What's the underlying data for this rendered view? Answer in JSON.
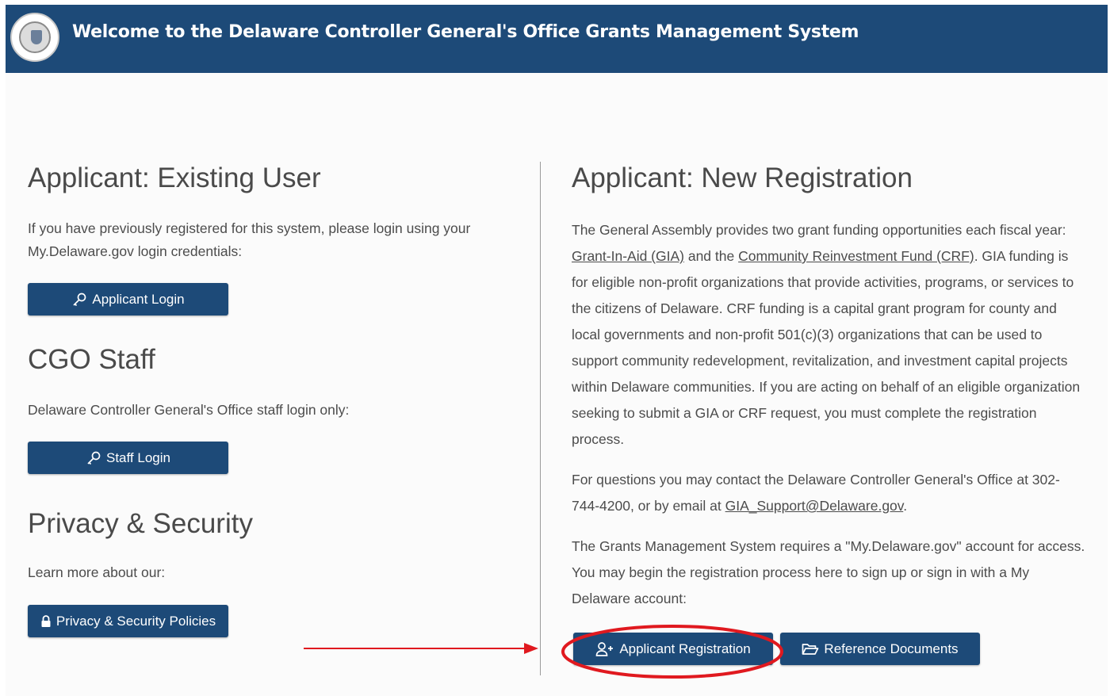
{
  "header": {
    "title": "Welcome to the Delaware Controller General's Office Grants Management System",
    "seal_icon": "delaware-state-seal",
    "background_color": "#1d4a78"
  },
  "existing_user": {
    "heading": "Applicant: Existing User",
    "text": "If you have previously registered for this system, please login using your My.Delaware.gov login credentials:",
    "button_label": "Applicant Login",
    "button_icon": "key-icon"
  },
  "staff": {
    "heading": "CGO Staff",
    "text": "Delaware Controller General's Office staff login only:",
    "button_label": "Staff Login",
    "button_icon": "key-icon"
  },
  "privacy": {
    "heading": "Privacy & Security",
    "text": "Learn more about our:",
    "button_label": "Privacy & Security Policies",
    "button_icon": "lock-icon"
  },
  "registration": {
    "heading": "Applicant: New Registration",
    "p1_a": "The General Assembly provides two grant funding opportunities each fiscal year: ",
    "gia_link": "Grant-In-Aid (GIA)",
    "p1_b": " and the ",
    "crf_link": "Community Reinvestment Fund (CRF)",
    "p1_c": ". GIA funding is for eligible non-profit organizations that provide activities, programs, or services to the citizens of Delaware. CRF funding is a capital grant program for county and local governments and non-profit 501(c)(3) organizations that can be used to support community redevelopment, revitalization, and investment capital projects within Delaware communities. If you are acting on behalf of an eligible organization seeking to submit a GIA or CRF request, you must complete the registration process.",
    "p2_a": "For questions you may contact the Delaware Controller General's Office at 302-744-4200, or by email at ",
    "email_link": "GIA_Support@Delaware.gov",
    "p2_b": ".",
    "p3": "The Grants Management System requires a \"My.Delaware.gov\" account for access. You may begin the registration process here to sign up or sign in with a My Delaware account:",
    "register_button_label": "Applicant Registration",
    "register_button_icon": "user-plus-icon",
    "docs_button_label": "Reference Documents",
    "docs_button_icon": "folder-open-icon"
  },
  "annotation": {
    "color": "#e0191f",
    "arrow": "red-arrow",
    "highlight": "red-ellipse"
  }
}
